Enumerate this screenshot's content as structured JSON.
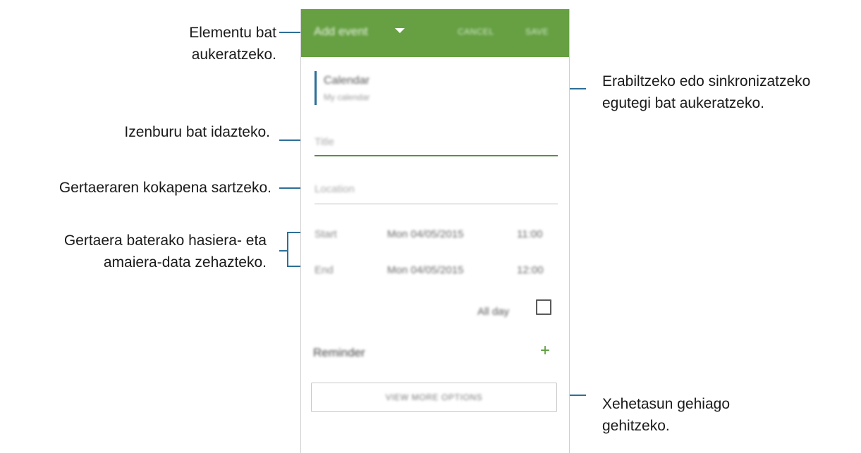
{
  "annotations": {
    "select_item": [
      "Elementu bat",
      "aukeratzeko."
    ],
    "calendar": [
      "Erabiltzeko edo sinkronizatzeko",
      "egutegi bat aukeratzeko."
    ],
    "title": [
      "Izenburu bat idazteko."
    ],
    "location": [
      "Gertaeraren kokapena sartzeko."
    ],
    "dates": [
      "Gertaera baterako hasiera- eta",
      "amaiera-data zehazteko."
    ],
    "details": [
      "Xehetasun gehiago",
      "gehitzeko."
    ]
  },
  "app": {
    "appbar": {
      "title": "Add event",
      "cancel_label": "CANCEL",
      "save_label": "SAVE",
      "accent_color": "#66a043"
    },
    "calendar": {
      "name": "Calendar",
      "account": "My calendar",
      "color": "#2c6f97"
    },
    "title_field": {
      "placeholder": "Title"
    },
    "location_field": {
      "placeholder": "Location"
    },
    "start": {
      "label": "Start",
      "date": "Mon 04/05/2015",
      "time": "11:00"
    },
    "end": {
      "label": "End",
      "date": "Mon 04/05/2015",
      "time": "12:00"
    },
    "all_day": {
      "label": "All day",
      "checked": false
    },
    "reminder": {
      "label": "Reminder",
      "add_icon": "plus-icon"
    },
    "more_options_label": "VIEW MORE OPTIONS"
  }
}
